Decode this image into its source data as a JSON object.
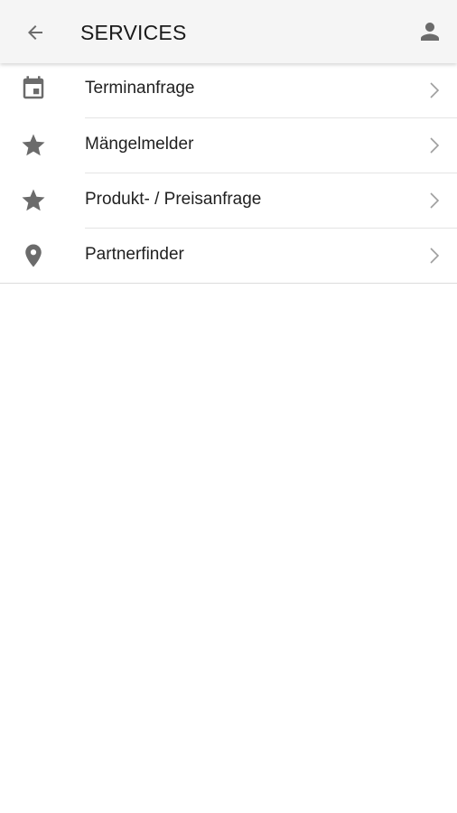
{
  "header": {
    "title": "SERVICES",
    "back_icon": "arrow-left-icon",
    "profile_icon": "person-icon"
  },
  "items": [
    {
      "label": "Terminanfrage",
      "icon": "calendar-icon"
    },
    {
      "label": "Mängelmelder",
      "icon": "star-icon"
    },
    {
      "label": "Produkt- / Preisanfrage",
      "icon": "star-icon"
    },
    {
      "label": "Partnerfinder",
      "icon": "location-pin-icon"
    }
  ],
  "colors": {
    "app_bar_bg": "#f5f5f5",
    "icon": "#6b6b6b",
    "chevron": "#9e9e9e",
    "text": "#212121"
  }
}
